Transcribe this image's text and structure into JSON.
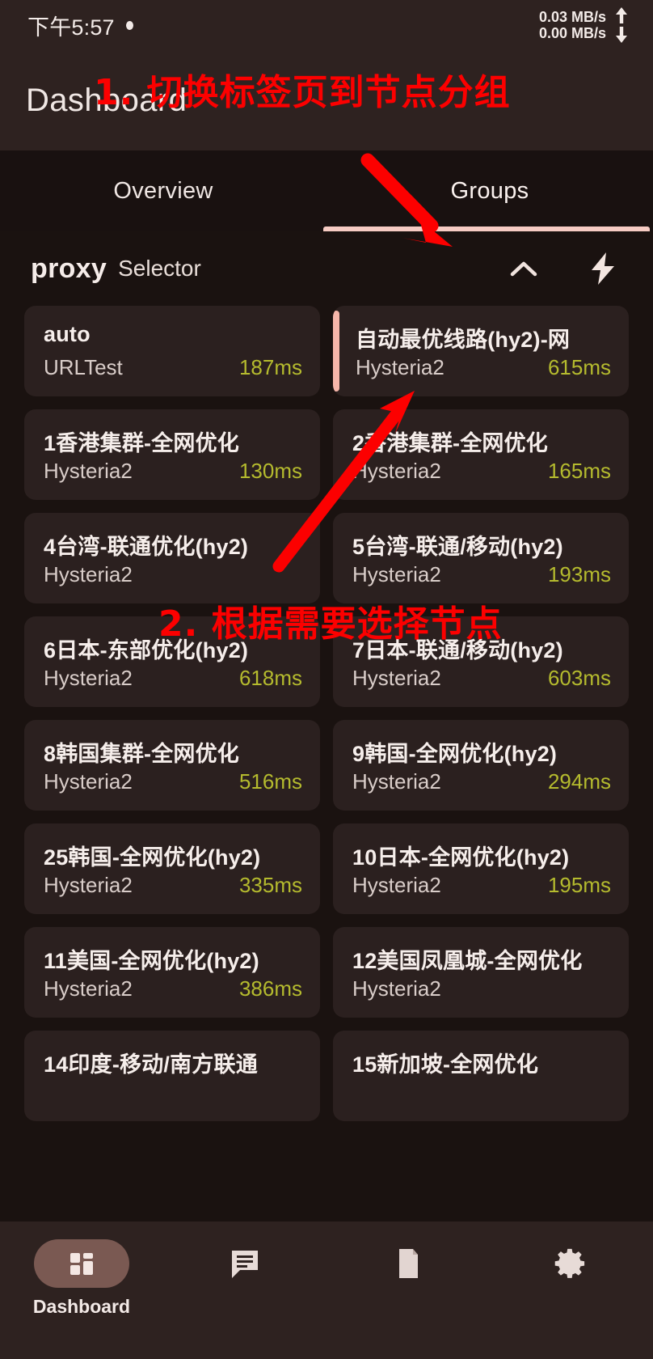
{
  "status_bar": {
    "time": "下午5:57",
    "upload_speed": "0.03 MB/s",
    "download_speed": "0.00 MB/s"
  },
  "app_bar": {
    "title": "Dashboard"
  },
  "tabs": [
    {
      "label": "Overview",
      "active": false
    },
    {
      "label": "Groups",
      "active": true
    }
  ],
  "group_header": {
    "name": "proxy",
    "type": "Selector",
    "collapse_icon": "chevron-up-icon",
    "speedtest_icon": "lightning-bolt-icon"
  },
  "nodes": [
    {
      "title": "auto",
      "protocol": "URLTest",
      "delay": "187ms",
      "selected": false
    },
    {
      "title": "自动最优线路(hy2)-网",
      "protocol": "Hysteria2",
      "delay": "615ms",
      "selected": true
    },
    {
      "title": "1香港集群-全网优化",
      "protocol": "Hysteria2",
      "delay": "130ms",
      "selected": false
    },
    {
      "title": "2香港集群-全网优化",
      "protocol": "Hysteria2",
      "delay": "165ms",
      "selected": false
    },
    {
      "title": "4台湾-联通优化(hy2)",
      "protocol": "Hysteria2",
      "delay": "",
      "selected": false
    },
    {
      "title": "5台湾-联通/移动(hy2)",
      "protocol": "Hysteria2",
      "delay": "193ms",
      "selected": false
    },
    {
      "title": "6日本-东部优化(hy2)",
      "protocol": "Hysteria2",
      "delay": "618ms",
      "selected": false
    },
    {
      "title": "7日本-联通/移动(hy2)",
      "protocol": "Hysteria2",
      "delay": "603ms",
      "selected": false
    },
    {
      "title": "8韩国集群-全网优化",
      "protocol": "Hysteria2",
      "delay": "516ms",
      "selected": false
    },
    {
      "title": "9韩国-全网优化(hy2)",
      "protocol": "Hysteria2",
      "delay": "294ms",
      "selected": false
    },
    {
      "title": "25韩国-全网优化(hy2)",
      "protocol": "Hysteria2",
      "delay": "335ms",
      "selected": false
    },
    {
      "title": "10日本-全网优化(hy2)",
      "protocol": "Hysteria2",
      "delay": "195ms",
      "selected": false
    },
    {
      "title": "11美国-全网优化(hy2)",
      "protocol": "Hysteria2",
      "delay": "386ms",
      "selected": false
    },
    {
      "title": "12美国凤凰城-全网优化",
      "protocol": "Hysteria2",
      "delay": "",
      "selected": false
    },
    {
      "title": "14印度-移动/南方联通",
      "protocol": "",
      "delay": "",
      "selected": false
    },
    {
      "title": "15新加坡-全网优化",
      "protocol": "",
      "delay": "",
      "selected": false
    }
  ],
  "bottom_nav": [
    {
      "label": "Dashboard",
      "icon": "dashboard-grid-icon",
      "active": true
    },
    {
      "label": "",
      "icon": "chat-message-icon",
      "active": false
    },
    {
      "label": "",
      "icon": "document-file-icon",
      "active": false
    },
    {
      "label": "",
      "icon": "gear-settings-icon",
      "active": false
    }
  ],
  "annotations": [
    {
      "text": "1. 切换标签页到节点分组",
      "color": "#fc0000"
    },
    {
      "text": "2. 根据需要选择节点",
      "color": "#fc0000"
    }
  ],
  "colors": {
    "page_background": "#1a1210",
    "surface": "#2e2220",
    "card": "#2b201f",
    "accent": "#f6cbc3",
    "selected_indicator": "#f6b6aa",
    "delay_text": "#b5bb2e",
    "annotation": "#fc0000"
  }
}
